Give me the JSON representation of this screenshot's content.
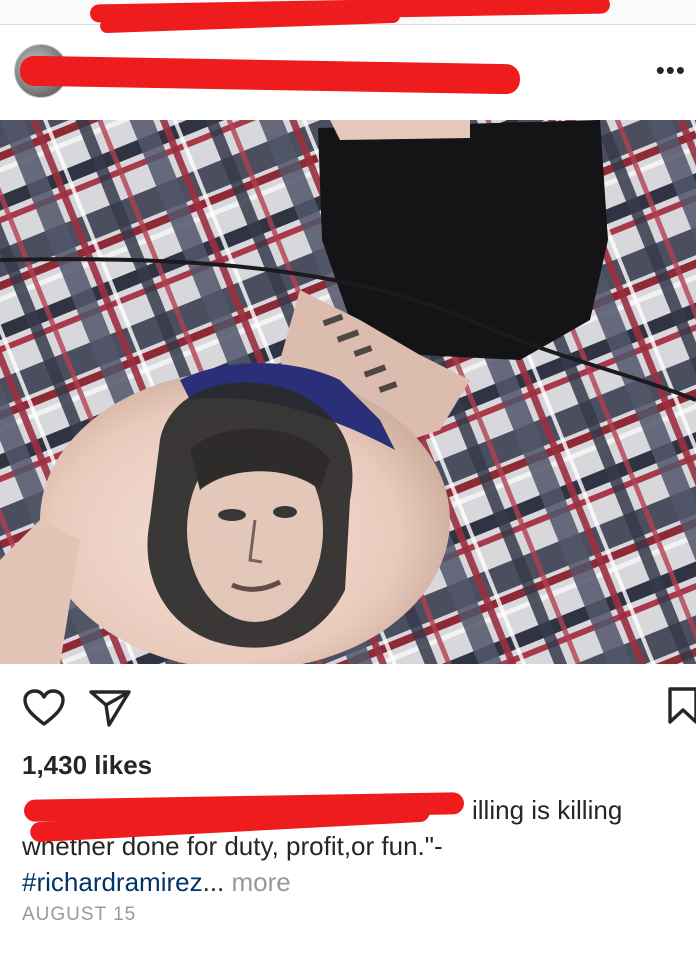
{
  "post": {
    "likes": "1,430 likes",
    "caption_line1": "illing is killing",
    "caption_line2": "whether done for duty, profit,or fun.\"-",
    "hashtag": "#richardramirez",
    "ellipsis": "...",
    "more": "more",
    "date": "AUGUST 15",
    "options_glyph": "•••"
  },
  "icons": {
    "like": "heart-icon",
    "share": "paper-plane-icon",
    "save": "bookmark-icon"
  },
  "colors": {
    "redaction": "#ee1c1c",
    "hashtag": "#003569",
    "muted": "#999999"
  }
}
